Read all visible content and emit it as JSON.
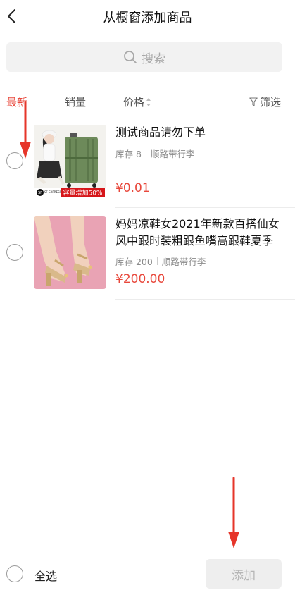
{
  "header": {
    "title": "从橱窗添加商品"
  },
  "search": {
    "placeholder": "搜索"
  },
  "filters": {
    "latest": "最新",
    "sales": "销量",
    "price": "价格",
    "filter": "筛选"
  },
  "products": [
    {
      "title": "测试商品请勿下单",
      "stock": "库存 8",
      "shop": "顺路带行李",
      "price": "¥0.01",
      "badge": "容量增加50%",
      "badge_brand": "SF EXPRESS"
    },
    {
      "title": "妈妈凉鞋女2021年新款百搭仙女风中跟时装粗跟鱼嘴高跟鞋夏季",
      "stock": "库存 200",
      "shop": "顺路带行李",
      "price": "¥200.00"
    }
  ],
  "bottom": {
    "select_all": "全选",
    "add": "添加"
  },
  "colors": {
    "accent": "#e8483c",
    "annotation_arrow": "#e6352a"
  }
}
